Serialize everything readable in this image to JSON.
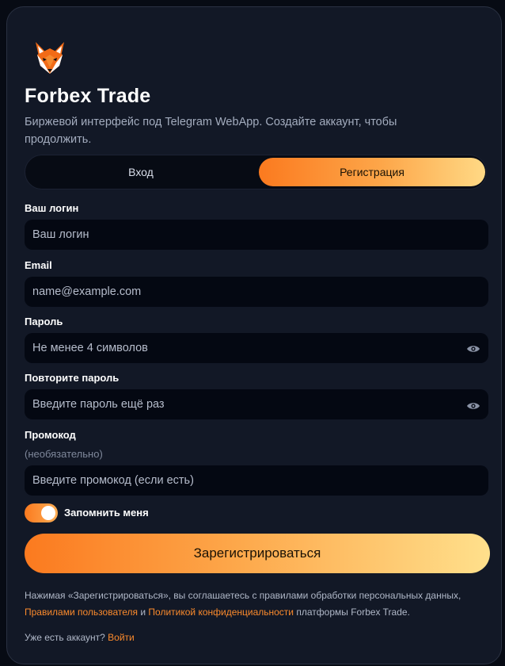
{
  "app": {
    "title": "Forbex Trade",
    "subtitle": "Биржевой интерфейс под Telegram WebApp. Создайте аккаунт, чтобы продолжить.",
    "logo_icon": "fox-logo-icon"
  },
  "tabs": {
    "login": "Вход",
    "register": "Регистрация",
    "active": "register"
  },
  "form": {
    "login_label": "Ваш логин",
    "login_placeholder": "Ваш логин",
    "email_label": "Email",
    "email_placeholder": "name@example.com",
    "password_label": "Пароль",
    "password_placeholder": "Не менее 4 символов",
    "password_repeat_label": "Повторите пароль",
    "password_repeat_placeholder": "Введите пароль ещё раз",
    "promo_label": "Промокод",
    "promo_hint": "(необязательно)",
    "promo_placeholder": "Введите промокод (если есть)",
    "remember_label": "Запомнить меня",
    "remember_checked": true,
    "submit_label": "Зарегистрироваться"
  },
  "legal": {
    "text_before": "Нажимая «Зарегистрироваться», вы соглашаетесь с правилами обработки персональных данных,",
    "terms_link": "Правилами пользователя",
    "and": "и",
    "privacy_link": "Политикой конфиденциальности",
    "text_after": "платформы Forbex Trade."
  },
  "footer": {
    "question": "Уже есть аккаунт?",
    "login_link": "Войти"
  },
  "colors": {
    "accent_start": "#fb7a1f",
    "accent_end": "#ffd985",
    "card_bg": "#121826",
    "input_bg": "#040812"
  }
}
